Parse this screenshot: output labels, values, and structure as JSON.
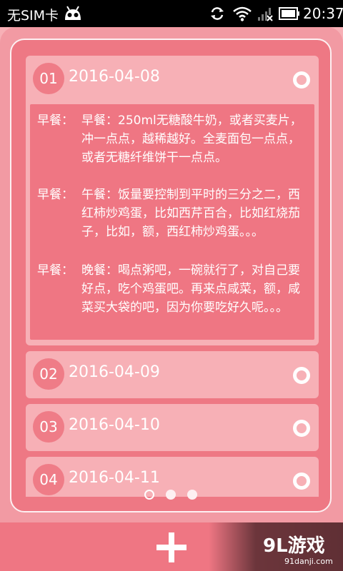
{
  "status_bar": {
    "carrier": "无SIM卡",
    "time": "20:37",
    "icons": [
      "android-icon",
      "sync-icon",
      "wifi-icon",
      "no-signal-icon",
      "battery-icon"
    ]
  },
  "entries": [
    {
      "number": "01",
      "date": "2016-04-08",
      "expanded": true,
      "meals": [
        {
          "label": "早餐：",
          "text": "早餐：250ml无糖酸牛奶，或者买麦片，冲一点点，越稀越好。全麦面包一点点，或者无糖纤维饼干一点点。"
        },
        {
          "label": "早餐：",
          "text": "午餐：饭量要控制到平时的三分之二，西红柿炒鸡蛋，比如西芹百合，比如红烧茄子，比如，额，西红柿炒鸡蛋。。。"
        },
        {
          "label": "早餐：",
          "text": "晚餐：喝点粥吧，一碗就行了，对自己要好点，吃个鸡蛋吧。再来点咸菜，额，咸菜买大袋的吧，因为你要吃好久呢。。。"
        }
      ]
    },
    {
      "number": "02",
      "date": "2016-04-09",
      "expanded": false
    },
    {
      "number": "03",
      "date": "2016-04-10",
      "expanded": false
    },
    {
      "number": "04",
      "date": "2016-04-11",
      "expanded": false
    }
  ],
  "pager": {
    "count": 3,
    "active_index": 0
  },
  "bottom_bar": {
    "add_icon": "plus-icon"
  },
  "watermark": {
    "title": "9L游戏",
    "url": "91danji.com"
  },
  "colors": {
    "background": "#f7b0b6",
    "accent": "#ef7683",
    "number_badge": "#ef7c87",
    "white": "#ffffff"
  }
}
